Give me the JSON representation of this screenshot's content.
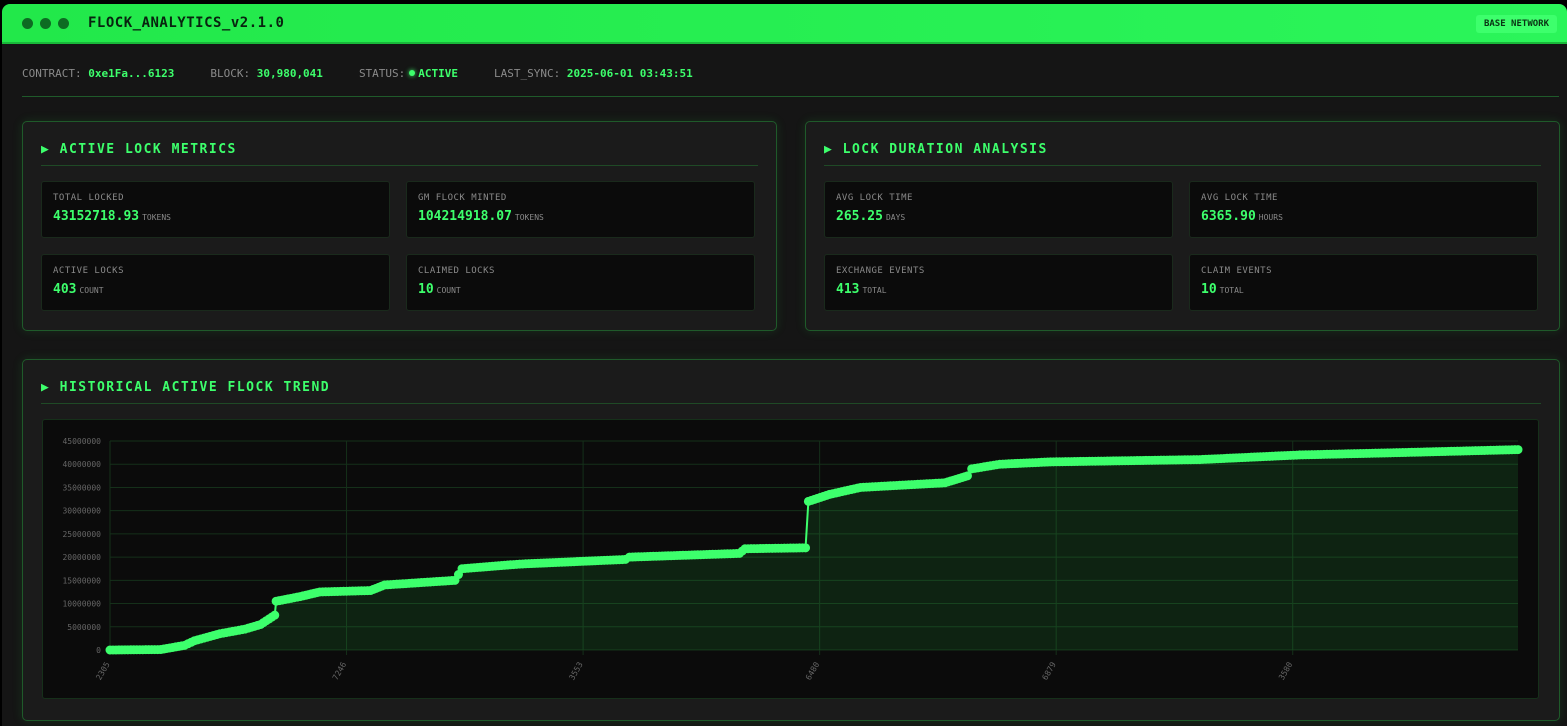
{
  "window": {
    "title": "FLOCK_ANALYTICS_v2.1.0",
    "network_badge": "BASE NETWORK"
  },
  "info": {
    "contract_label": "CONTRACT:",
    "contract": "0xe1Fa...6123",
    "block_label": "BLOCK:",
    "block": "30,980,041",
    "status_label": "STATUS:",
    "status": "ACTIVE",
    "sync_label": "LAST_SYNC:",
    "sync": "2025-06-01 03:43:51"
  },
  "metrics": {
    "title": "▶ ACTIVE LOCK METRICS",
    "cards": [
      {
        "label": "TOTAL LOCKED",
        "value": "43152718.93",
        "unit": "TOKENS"
      },
      {
        "label": "GM FLOCK MINTED",
        "value": "104214918.07",
        "unit": "TOKENS"
      },
      {
        "label": "ACTIVE LOCKS",
        "value": "403",
        "unit": "COUNT"
      },
      {
        "label": "CLAIMED LOCKS",
        "value": "10",
        "unit": "COUNT"
      }
    ]
  },
  "duration": {
    "title": "▶ LOCK DURATION ANALYSIS",
    "cards": [
      {
        "label": "AVG LOCK TIME",
        "value": "265.25",
        "unit": "DAYS"
      },
      {
        "label": "AVG LOCK TIME",
        "value": "6365.90",
        "unit": "HOURS"
      },
      {
        "label": "EXCHANGE EVENTS",
        "value": "413",
        "unit": "TOTAL"
      },
      {
        "label": "CLAIM EVENTS",
        "value": "10",
        "unit": "TOTAL"
      }
    ]
  },
  "trend": {
    "title": "▶ HISTORICAL ACTIVE FLOCK TREND"
  },
  "chart_data": {
    "type": "line",
    "title": "HISTORICAL ACTIVE FLOCK TREND",
    "xlabel": "",
    "ylabel": "",
    "ylim": [
      0,
      45000000
    ],
    "xlim": [
      0,
      1000
    ],
    "yticks": [
      0,
      5000000,
      10000000,
      15000000,
      20000000,
      25000000,
      30000000,
      35000000,
      40000000,
      45000000
    ],
    "xtick_positions": [
      0,
      168,
      336,
      504,
      672,
      840
    ],
    "xtick_labels": [
      "2305",
      "7246",
      "3553",
      "6480",
      "6879",
      "3580"
    ],
    "grid": true,
    "color": "#3dff6c",
    "x": [
      0,
      36,
      53,
      60,
      78,
      96,
      107,
      117,
      118,
      135,
      149,
      185,
      195,
      245,
      250,
      291,
      366,
      369,
      447,
      451,
      494,
      496,
      511,
      533,
      593,
      609,
      612,
      632,
      668,
      774,
      845,
      916,
      1000
    ],
    "y": [
      0,
      100000,
      1000000,
      2000000,
      3500000,
      4500000,
      5500000,
      7500000,
      10500000,
      11500000,
      12500000,
      12800000,
      14000000,
      15000000,
      17500000,
      18500000,
      19500000,
      20000000,
      20800000,
      21800000,
      22000000,
      32000000,
      33500000,
      35000000,
      36000000,
      37500000,
      39000000,
      40000000,
      40500000,
      41000000,
      42000000,
      42500000,
      43150000
    ]
  }
}
